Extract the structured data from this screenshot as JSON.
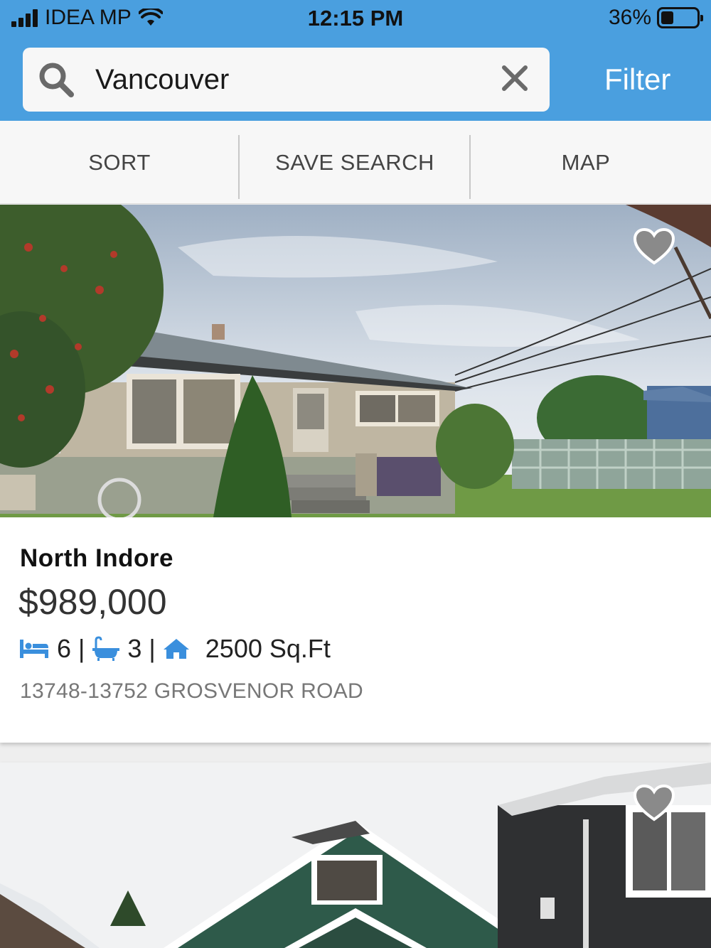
{
  "status_bar": {
    "carrier": "IDEA MP",
    "time": "12:15 PM",
    "battery_percent": "36%",
    "battery_level": 0.36
  },
  "search": {
    "value": "Vancouver"
  },
  "header": {
    "filter_label": "Filter"
  },
  "tabs": [
    {
      "label": "SORT"
    },
    {
      "label": "SAVE SEARCH"
    },
    {
      "label": "MAP"
    }
  ],
  "colors": {
    "header_bg": "#4a9fdf",
    "icon_blue": "#3a8fdd",
    "heart_gray": "#8a8a8a"
  },
  "listings": [
    {
      "name": "North Indore",
      "price": "$989,000",
      "beds": "6",
      "baths": "3",
      "area": "2500 Sq.Ft",
      "separator": "|",
      "address": "13748-13752 GROSVENOR ROAD",
      "favorited": false
    },
    {
      "favorited": false
    }
  ]
}
